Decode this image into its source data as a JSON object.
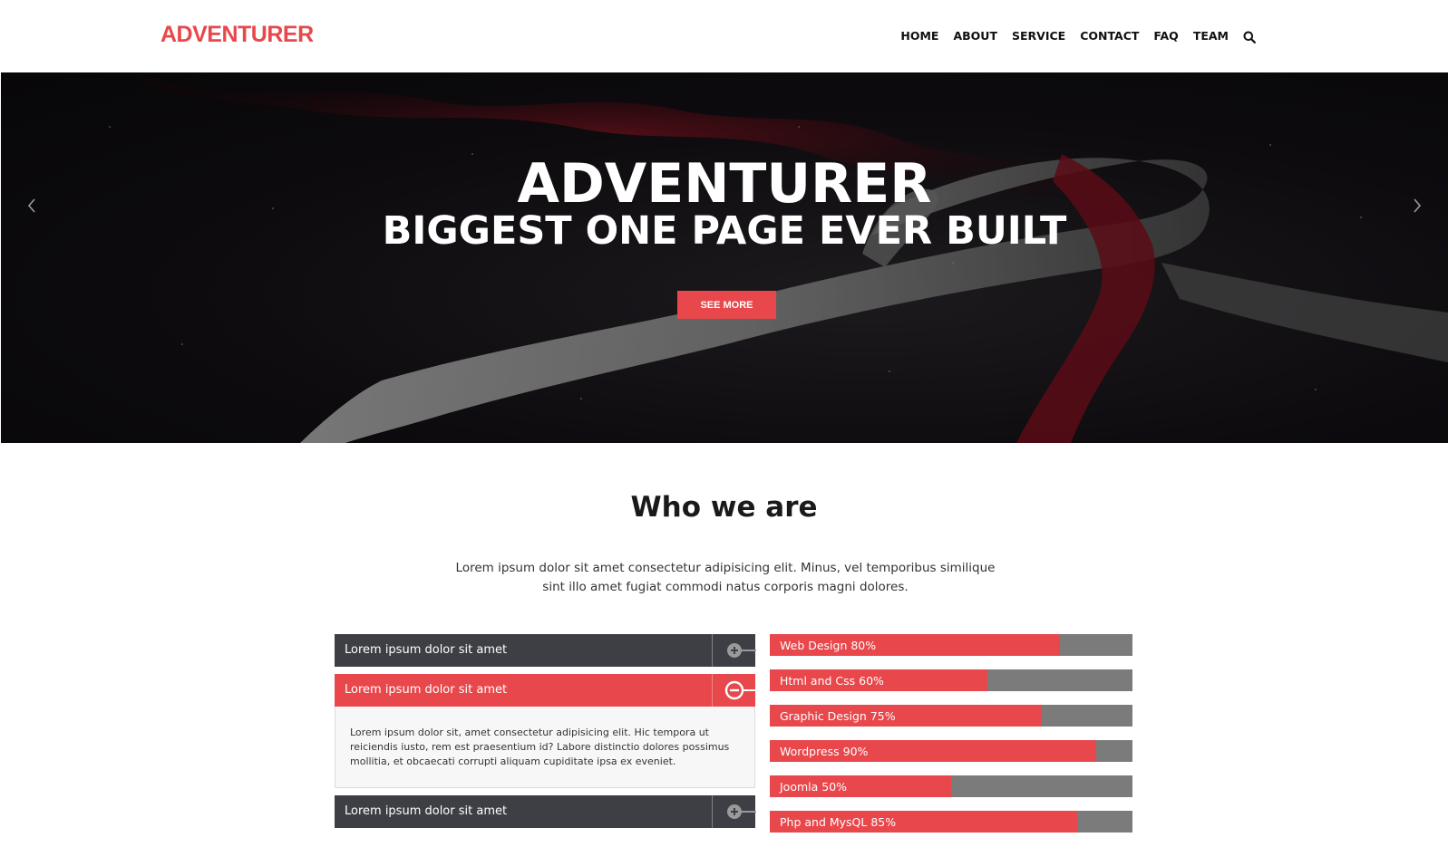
{
  "brand": {
    "logo": "ADVENTURER",
    "accent": "#e8474b"
  },
  "nav": {
    "items": [
      "HOME",
      "ABOUT",
      "SERVICE",
      "CONTACT",
      "FAQ",
      "TEAM"
    ],
    "search_icon": "search-icon"
  },
  "hero": {
    "title": "ADVENTURER",
    "subtitle": "BIGGEST ONE PAGE EVER BUILT",
    "button": "SEE MORE",
    "prev_icon": "chevron-left-icon",
    "next_icon": "chevron-right-icon"
  },
  "about": {
    "title": "Who we are",
    "text": "Lorem ipsum dolor sit amet consectetur adipisicing elit. Minus, vel temporibus similique sint illo amet fugiat commodi natus corporis magni dolores."
  },
  "accordion": [
    {
      "label": "Lorem ipsum dolor sit amet",
      "expanded": false
    },
    {
      "label": "Lorem ipsum dolor sit amet",
      "expanded": true,
      "body": "Lorem ipsum dolor sit, amet consectetur adipisicing elit. Hic tempora ut reiciendis iusto, rem est praesentium id? Labore distinctio dolores possimus mollitia, et obcaecati corrupti aliquam cupiditate ipsa ex eveniet."
    },
    {
      "label": "Lorem ipsum dolor sit amet",
      "expanded": false
    }
  ],
  "skills": [
    {
      "label": "Web Design 80%",
      "percent": 80
    },
    {
      "label": "Html and Css 60%",
      "percent": 60
    },
    {
      "label": "Graphic Design 75%",
      "percent": 75
    },
    {
      "label": "Wordpress 90%",
      "percent": 90
    },
    {
      "label": "Joomla 50%",
      "percent": 50
    },
    {
      "label": "Php and MysQL 85%",
      "percent": 85
    }
  ]
}
